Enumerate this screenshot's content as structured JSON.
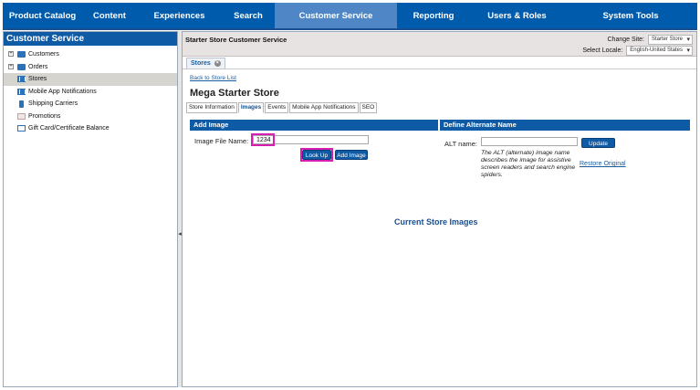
{
  "top_nav": {
    "items": [
      {
        "label": "Product Catalog"
      },
      {
        "label": "Content"
      },
      {
        "label": "Experiences"
      },
      {
        "label": "Search"
      },
      {
        "label": "Customer Service"
      },
      {
        "label": "Reporting"
      },
      {
        "label": "Users & Roles"
      },
      {
        "label": "System Tools"
      }
    ],
    "active_index": 4
  },
  "sidebar": {
    "title": "Customer Service",
    "items": [
      {
        "label": "Customers",
        "icon": "folder-icon",
        "expandable": true
      },
      {
        "label": "Orders",
        "icon": "folder-icon",
        "expandable": true
      },
      {
        "label": "Stores",
        "icon": "store-icon",
        "selected": true
      },
      {
        "label": "Mobile App Notifications",
        "icon": "store-icon"
      },
      {
        "label": "Shipping Carriers",
        "icon": "phone-icon"
      },
      {
        "label": "Promotions",
        "icon": "promotion-icon"
      },
      {
        "label": "Gift Card/Certificate Balance",
        "icon": "document-icon"
      }
    ]
  },
  "header": {
    "title": "Starter Store Customer Service",
    "change_site_label": "Change Site:",
    "change_site_value": "Starter Store",
    "locale_label": "Select Locale:",
    "locale_value": "English-United States"
  },
  "tab": {
    "label": "Stores",
    "close": "×"
  },
  "main": {
    "back_link": "Back to Store List",
    "store_name": "Mega Starter Store",
    "subtabs": [
      "Store Information",
      "Images",
      "Events",
      "Mobile App Notifications",
      "SEO"
    ],
    "active_subtab": 1,
    "add_image": {
      "heading": "Add Image",
      "file_label": "Image File Name:",
      "file_value": "1234",
      "lookup_button": "Look Up",
      "add_button": "Add Image"
    },
    "alt_name": {
      "heading": "Define Alternate Name",
      "alt_label": "ALT name:",
      "alt_value": "",
      "update_button": "Update",
      "note": "The ALT (alternate) image name describes the image for assistive screen readers and search engine spiders.",
      "restore_link": "Restore Original"
    },
    "current_images_title": "Current Store Images"
  },
  "colors": {
    "nav_bg": "#005bac",
    "nav_active": "#4f86c6",
    "section_head": "#0f5aa5",
    "highlight": "#d61fb0"
  }
}
